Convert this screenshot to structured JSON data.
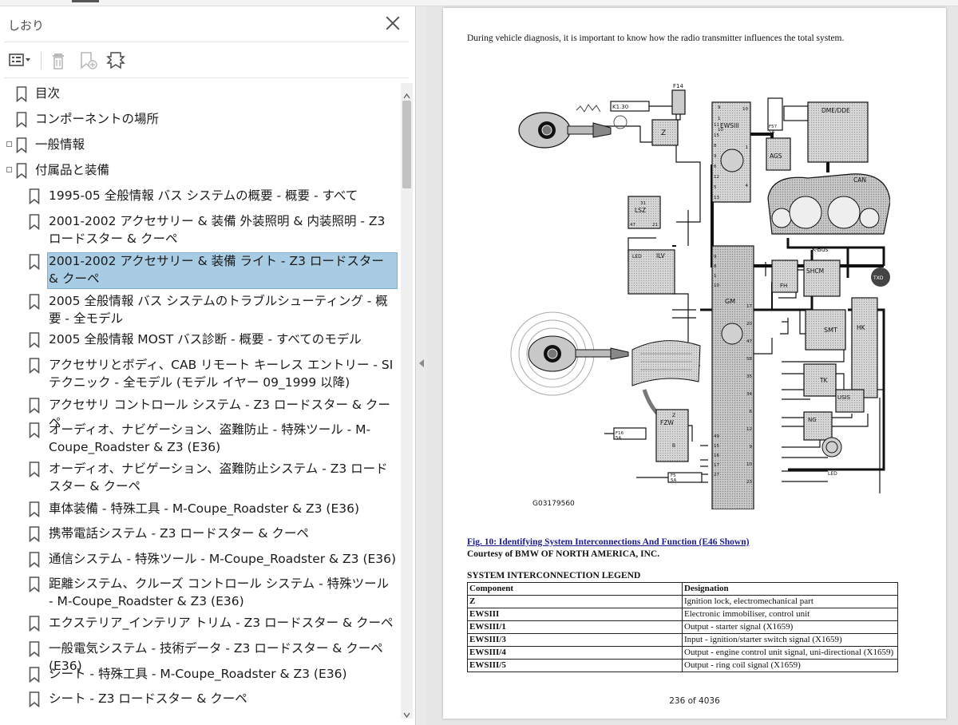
{
  "sidebar": {
    "title": "しおり",
    "toolbar": {
      "options_icon": "list-options-icon",
      "delete_icon": "trash-icon",
      "add_bookmark_icon": "bookmark-add-icon",
      "tag_bookmark_icon": "bookmark-tag-icon"
    },
    "items": [
      {
        "label": "目次"
      },
      {
        "label": "コンポーネントの場所"
      },
      {
        "label": "一般情報"
      },
      {
        "label": "付属品と装備"
      },
      {
        "label": "1995-05 全般情報 バス システムの概要 - 概要 - すべて"
      },
      {
        "label": "2001-2002 アクセサリー & 装備 外装照明 & 内装照明 - Z3 ロードスター & クーペ"
      },
      {
        "label": "2001-2002 アクセサリー & 装備 ライト - Z3 ロードスター & クーペ"
      },
      {
        "label": "2005 全般情報 バス システムのトラブルシューティング - 概要 - 全モデル"
      },
      {
        "label": "2005 全般情報 MOST バス診断 - 概要 - すべてのモデル"
      },
      {
        "label": "アクセサリとボディ、CAB リモート キーレス エントリー - SI テクニック - 全モデル (モデル イヤー 09_1999 以降)"
      },
      {
        "label": "アクセサリ コントロール システム - Z3 ロードスター & クーペ"
      },
      {
        "label": "オーディオ、ナビゲーション、盗難防止 - 特殊ツール - M-Coupe_Roadster & Z3 (E36)"
      },
      {
        "label": "オーディオ、ナビゲーション、盗難防止システム - Z3 ロードスター & クーペ"
      },
      {
        "label": "車体装備 - 特殊工具 - M-Coupe_Roadster & Z3 (E36)"
      },
      {
        "label": "携帯電話システム - Z3 ロードスター & クーペ"
      },
      {
        "label": "通信システム - 特殊ツール - M-Coupe_Roadster & Z3 (E36)"
      },
      {
        "label": "距離システム、クルーズ コントロール システム - 特殊ツール - M-Coupe_Roadster & Z3 (E36)"
      },
      {
        "label": "エクステリア_インテリア トリム - Z3 ロードスター & クーペ"
      },
      {
        "label": "一般電気システム - 技術データ - Z3 ロードスター & クーペ (E36)"
      },
      {
        "label": "シート - 特殊工具 - M-Coupe_Roadster & Z3 (E36)"
      },
      {
        "label": "シート - Z3 ロードスター & クーペ"
      }
    ]
  },
  "document": {
    "intro": "During vehicle diagnosis, it is important to know how the radio transmitter influences the total system.",
    "diagram": {
      "figure_id": "G03179560",
      "labels": {
        "k130": "K1.30",
        "f14": "F14",
        "ewsiii": "EWSIII",
        "dme": "DME/DDE",
        "f57": "F57",
        "f57_amp": "5A",
        "ags": "AGS",
        "z": "Z",
        "can": "CAN",
        "lsz": "LSZ",
        "kbus": "K-Bus",
        "ilv": "ILV",
        "led": "LED",
        "gm": "GM",
        "fh": "FH",
        "shcm": "SHCM",
        "txd": "TXD",
        "smt": "SMT",
        "hk": "HK",
        "tk": "TK",
        "usis": "USIS",
        "ng": "NG",
        "fzw": "FZW",
        "f16": "F16",
        "f16_amp": "5A",
        "f5": "F5",
        "f5_amp": "5A",
        "led2": "LED",
        "p_31": "31",
        "p_47": "47",
        "p_21": "21",
        "p_z": "Z",
        "p_b": "B"
      },
      "pins_ews_left": [
        "11",
        "15",
        "8",
        "9",
        "6",
        "12",
        "5",
        "13"
      ],
      "pins_ews_right": [
        "10",
        "1",
        "4"
      ],
      "pins_ews_top": [
        "9",
        "1",
        "10"
      ],
      "pins_gm_left": [
        "9",
        "8",
        "1",
        "10"
      ],
      "pins_gm_left_low": [
        "49",
        "15",
        "16",
        "17",
        "27"
      ],
      "pins_gm_right": [
        "17",
        "20",
        "47",
        "58",
        "35",
        "34",
        "6",
        "12",
        "9",
        "10",
        "23"
      ]
    },
    "fig_caption": "Fig. 10: Identifying System Interconnections And Function (E46 Shown)",
    "courtesy": "Courtesy of BMW OF NORTH AMERICA, INC.",
    "legend_title": "SYSTEM INTERCONNECTION LEGEND",
    "table": {
      "headers": [
        "Component",
        "Designation"
      ],
      "rows": [
        [
          "Z",
          "Ignition lock, electromechanical part"
        ],
        [
          "EWSIII",
          "Electronic immobiliser, control unit"
        ],
        [
          "EWSIII/1",
          "Output - starter signal (X1659)"
        ],
        [
          "EWSIII/3",
          "Input - ignition/starter switch signal (X1659)"
        ],
        [
          "EWSIII/4",
          "Output - engine control unit signal, uni-directional (X1659)"
        ],
        [
          "EWSIII/5",
          "Output - ring coil signal (X1659)"
        ]
      ]
    },
    "page_number": "236 of 4036"
  }
}
